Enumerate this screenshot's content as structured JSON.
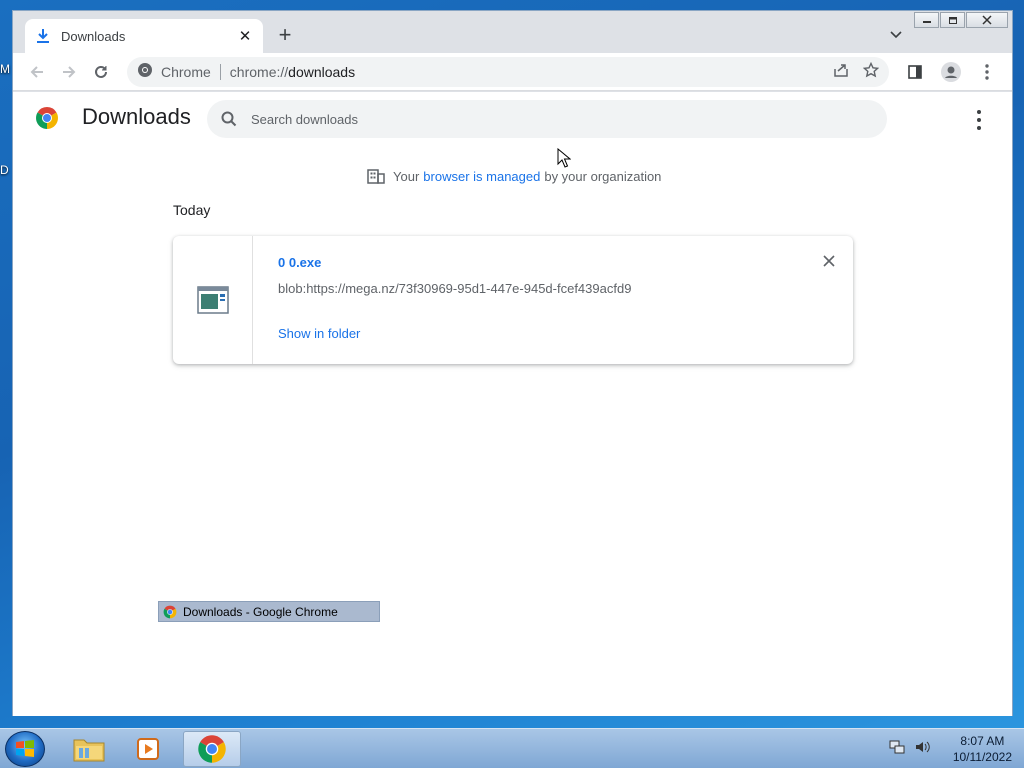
{
  "desktop": {
    "edge_labels": [
      "M",
      "D"
    ]
  },
  "window": {
    "tab": {
      "title": "Downloads"
    },
    "caption_buttons": [
      "minimize",
      "restore",
      "close"
    ]
  },
  "toolbar": {
    "site_label": "Chrome",
    "url_scheme": "chrome://",
    "url_path": "downloads"
  },
  "page": {
    "title": "Downloads",
    "search_placeholder": "Search downloads",
    "managed": {
      "prefix": "Your",
      "link": "browser is managed",
      "suffix": "by your organization"
    },
    "section_label": "Today",
    "download": {
      "filename": "0 0.exe",
      "url": "blob:https://mega.nz/73f30969-95d1-447e-945d-fcef439acfd9",
      "action": "Show in folder"
    }
  },
  "tooltip": {
    "text": "Downloads - Google Chrome"
  },
  "taskbar": {
    "items": [
      "file-explorer",
      "media-player",
      "chrome"
    ],
    "time": "8:07 AM",
    "date": "10/11/2022"
  },
  "colors": {
    "link": "#1a73e8",
    "accent_blue": "#1a73e8"
  }
}
